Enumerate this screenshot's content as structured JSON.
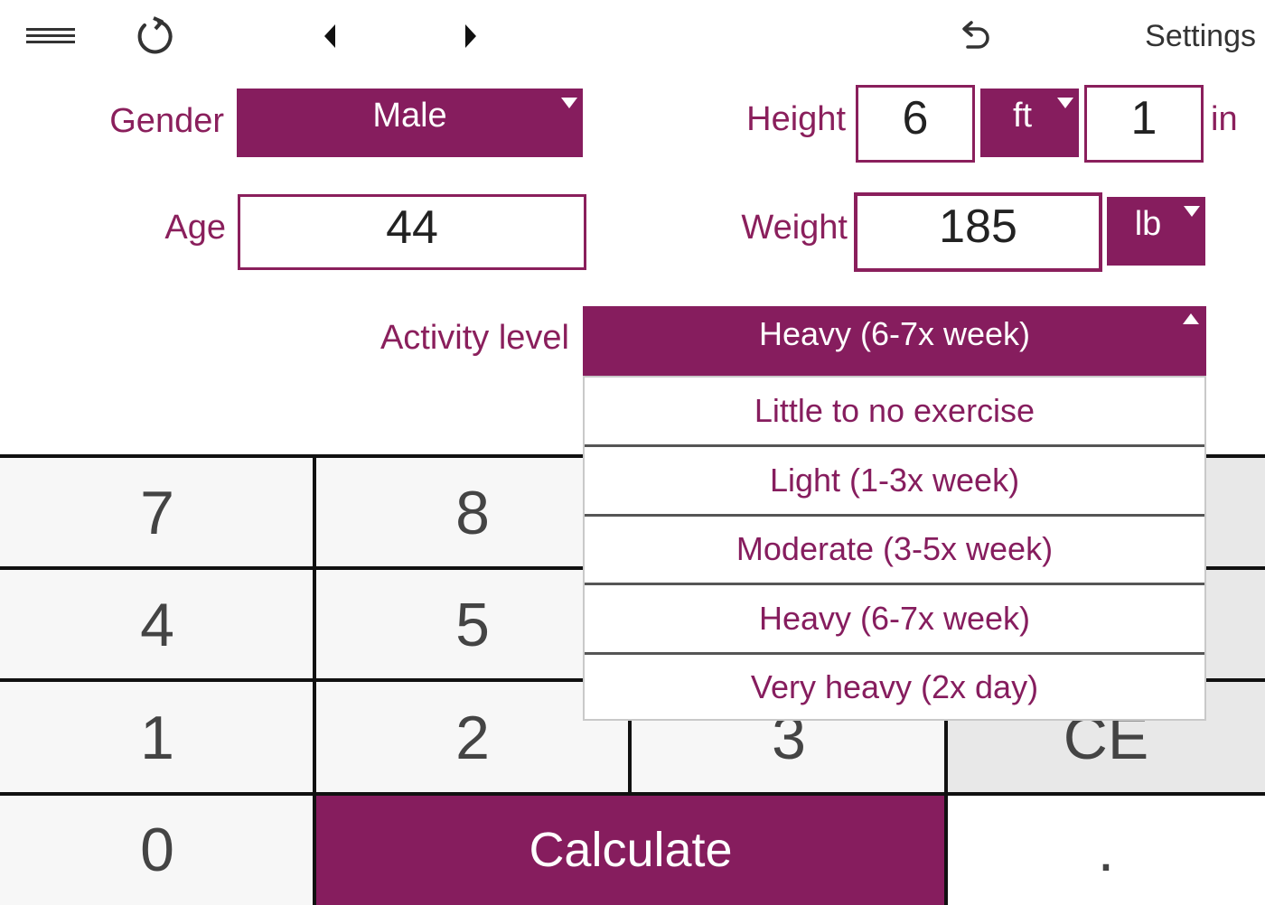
{
  "toolbar": {
    "menu_icon": "hamburger-menu-icon",
    "reset_icon": "reset-icon",
    "prev_icon": "caret-left-icon",
    "next_icon": "caret-right-icon",
    "undo_icon": "undo-icon",
    "settings_label": "Settings"
  },
  "form": {
    "gender": {
      "label": "Gender",
      "value": "Male"
    },
    "age": {
      "label": "Age",
      "value": "44"
    },
    "height": {
      "label": "Height",
      "feet": "6",
      "unit": "ft",
      "inches": "1",
      "inches_unit": "in"
    },
    "weight": {
      "label": "Weight",
      "value": "185",
      "unit": "lb"
    },
    "activity": {
      "label": "Activity level",
      "selected": "Heavy (6-7x week)",
      "options": [
        "Little to no exercise",
        "Light (1-3x week)",
        "Moderate (3-5x week)",
        "Heavy (6-7x week)",
        "Very heavy (2x day)"
      ]
    }
  },
  "keypad": {
    "row1": [
      "7",
      "8"
    ],
    "row2": [
      "4",
      "5"
    ],
    "row3": [
      "1",
      "2",
      "3",
      "CE"
    ],
    "row4": {
      "zero": "0",
      "calculate": "Calculate",
      "dot": "."
    }
  },
  "colors": {
    "accent": "#861d5e",
    "label_text": "#8a1f5c",
    "key_bg": "#f7f7f7",
    "key_grey_bg": "#e8e8e8"
  }
}
